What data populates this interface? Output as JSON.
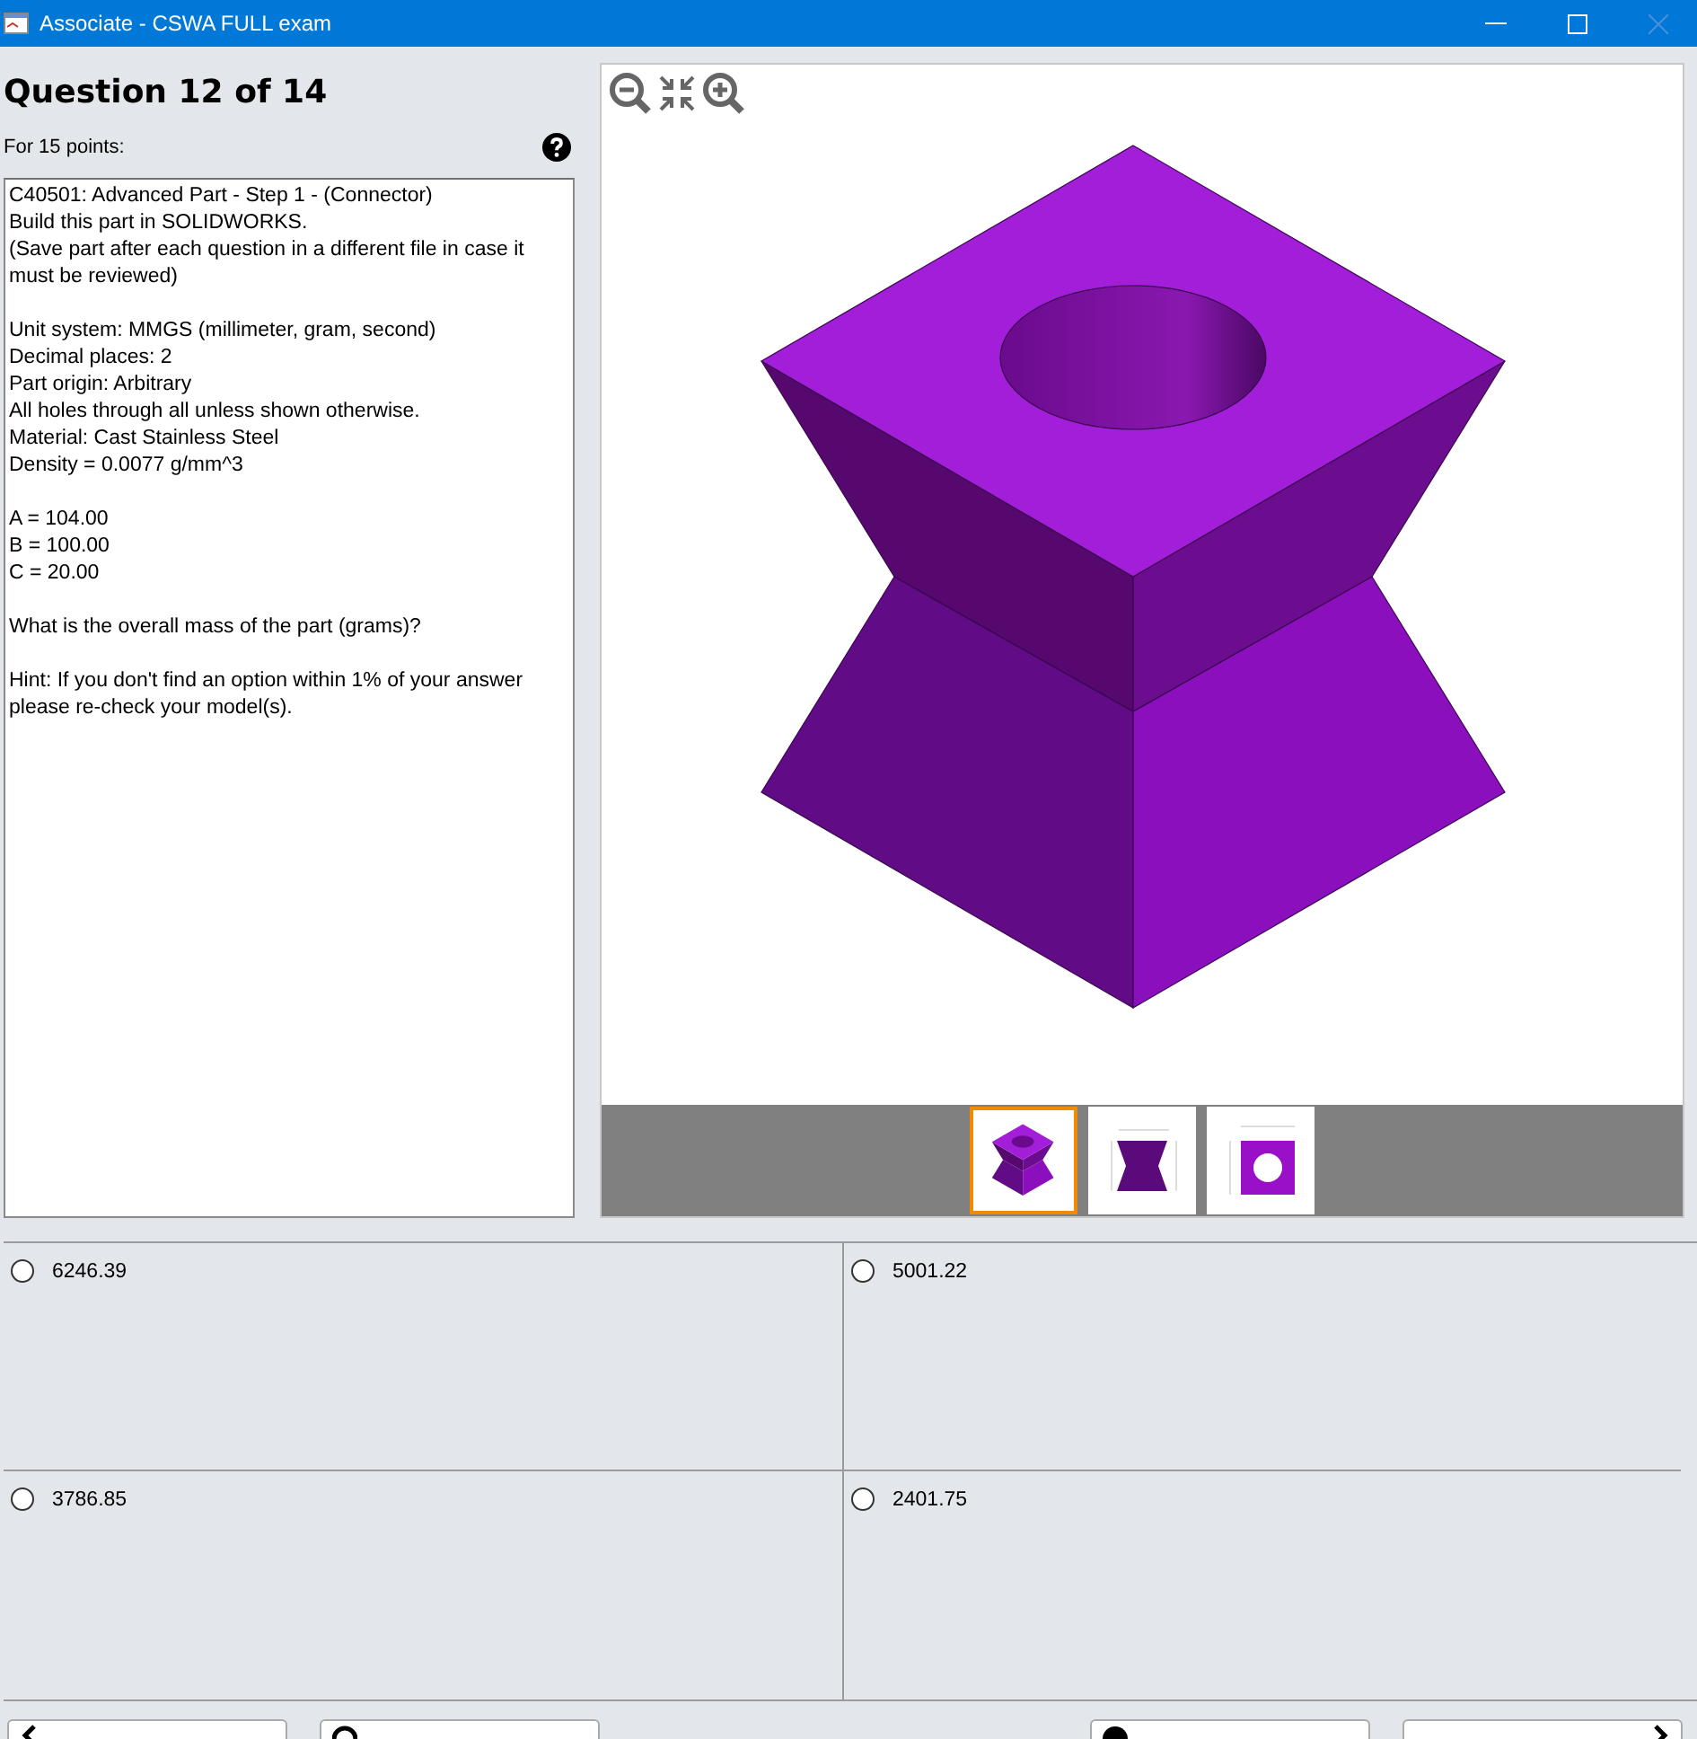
{
  "window": {
    "title": "Associate - CSWA FULL exam"
  },
  "question": {
    "heading": "Question 12 of 14",
    "points": "For 15 points:",
    "paragraphs": [
      [
        "C40501:  Advanced Part - Step 1 - (Connector)",
        "Build this part in SOLIDWORKS.",
        "(Save part after each question in a different file in case it must be reviewed)"
      ],
      [
        "Unit system: MMGS (millimeter, gram, second)",
        "Decimal places: 2",
        "Part origin: Arbitrary",
        "All holes through all unless shown otherwise.",
        "Material: Cast Stainless Steel",
        "Density = 0.0077 g/mm^3"
      ],
      [
        "A = 104.00",
        "B = 100.00",
        "C = 20.00"
      ],
      [
        "What is the overall mass of the part (grams)?"
      ],
      [
        "Hint: If you don't find an option within 1% of your answer please re-check your model(s)."
      ]
    ]
  },
  "viewer": {
    "tools": [
      {
        "kind": "zoom-out"
      },
      {
        "kind": "fit"
      },
      {
        "kind": "zoom-in"
      }
    ],
    "thumbnails": [
      {
        "kind": "iso",
        "selected": true
      },
      {
        "kind": "front",
        "selected": false
      },
      {
        "kind": "top",
        "selected": false
      }
    ]
  },
  "answers": [
    {
      "label": "6246.39",
      "selected": false
    },
    {
      "label": "5001.22",
      "selected": false
    },
    {
      "label": "3786.85",
      "selected": false
    },
    {
      "label": "2401.75",
      "selected": false
    }
  ],
  "buttons": [
    {
      "kind": "previous"
    },
    {
      "kind": "reset"
    },
    {
      "kind": "show"
    },
    {
      "kind": "next"
    }
  ]
}
